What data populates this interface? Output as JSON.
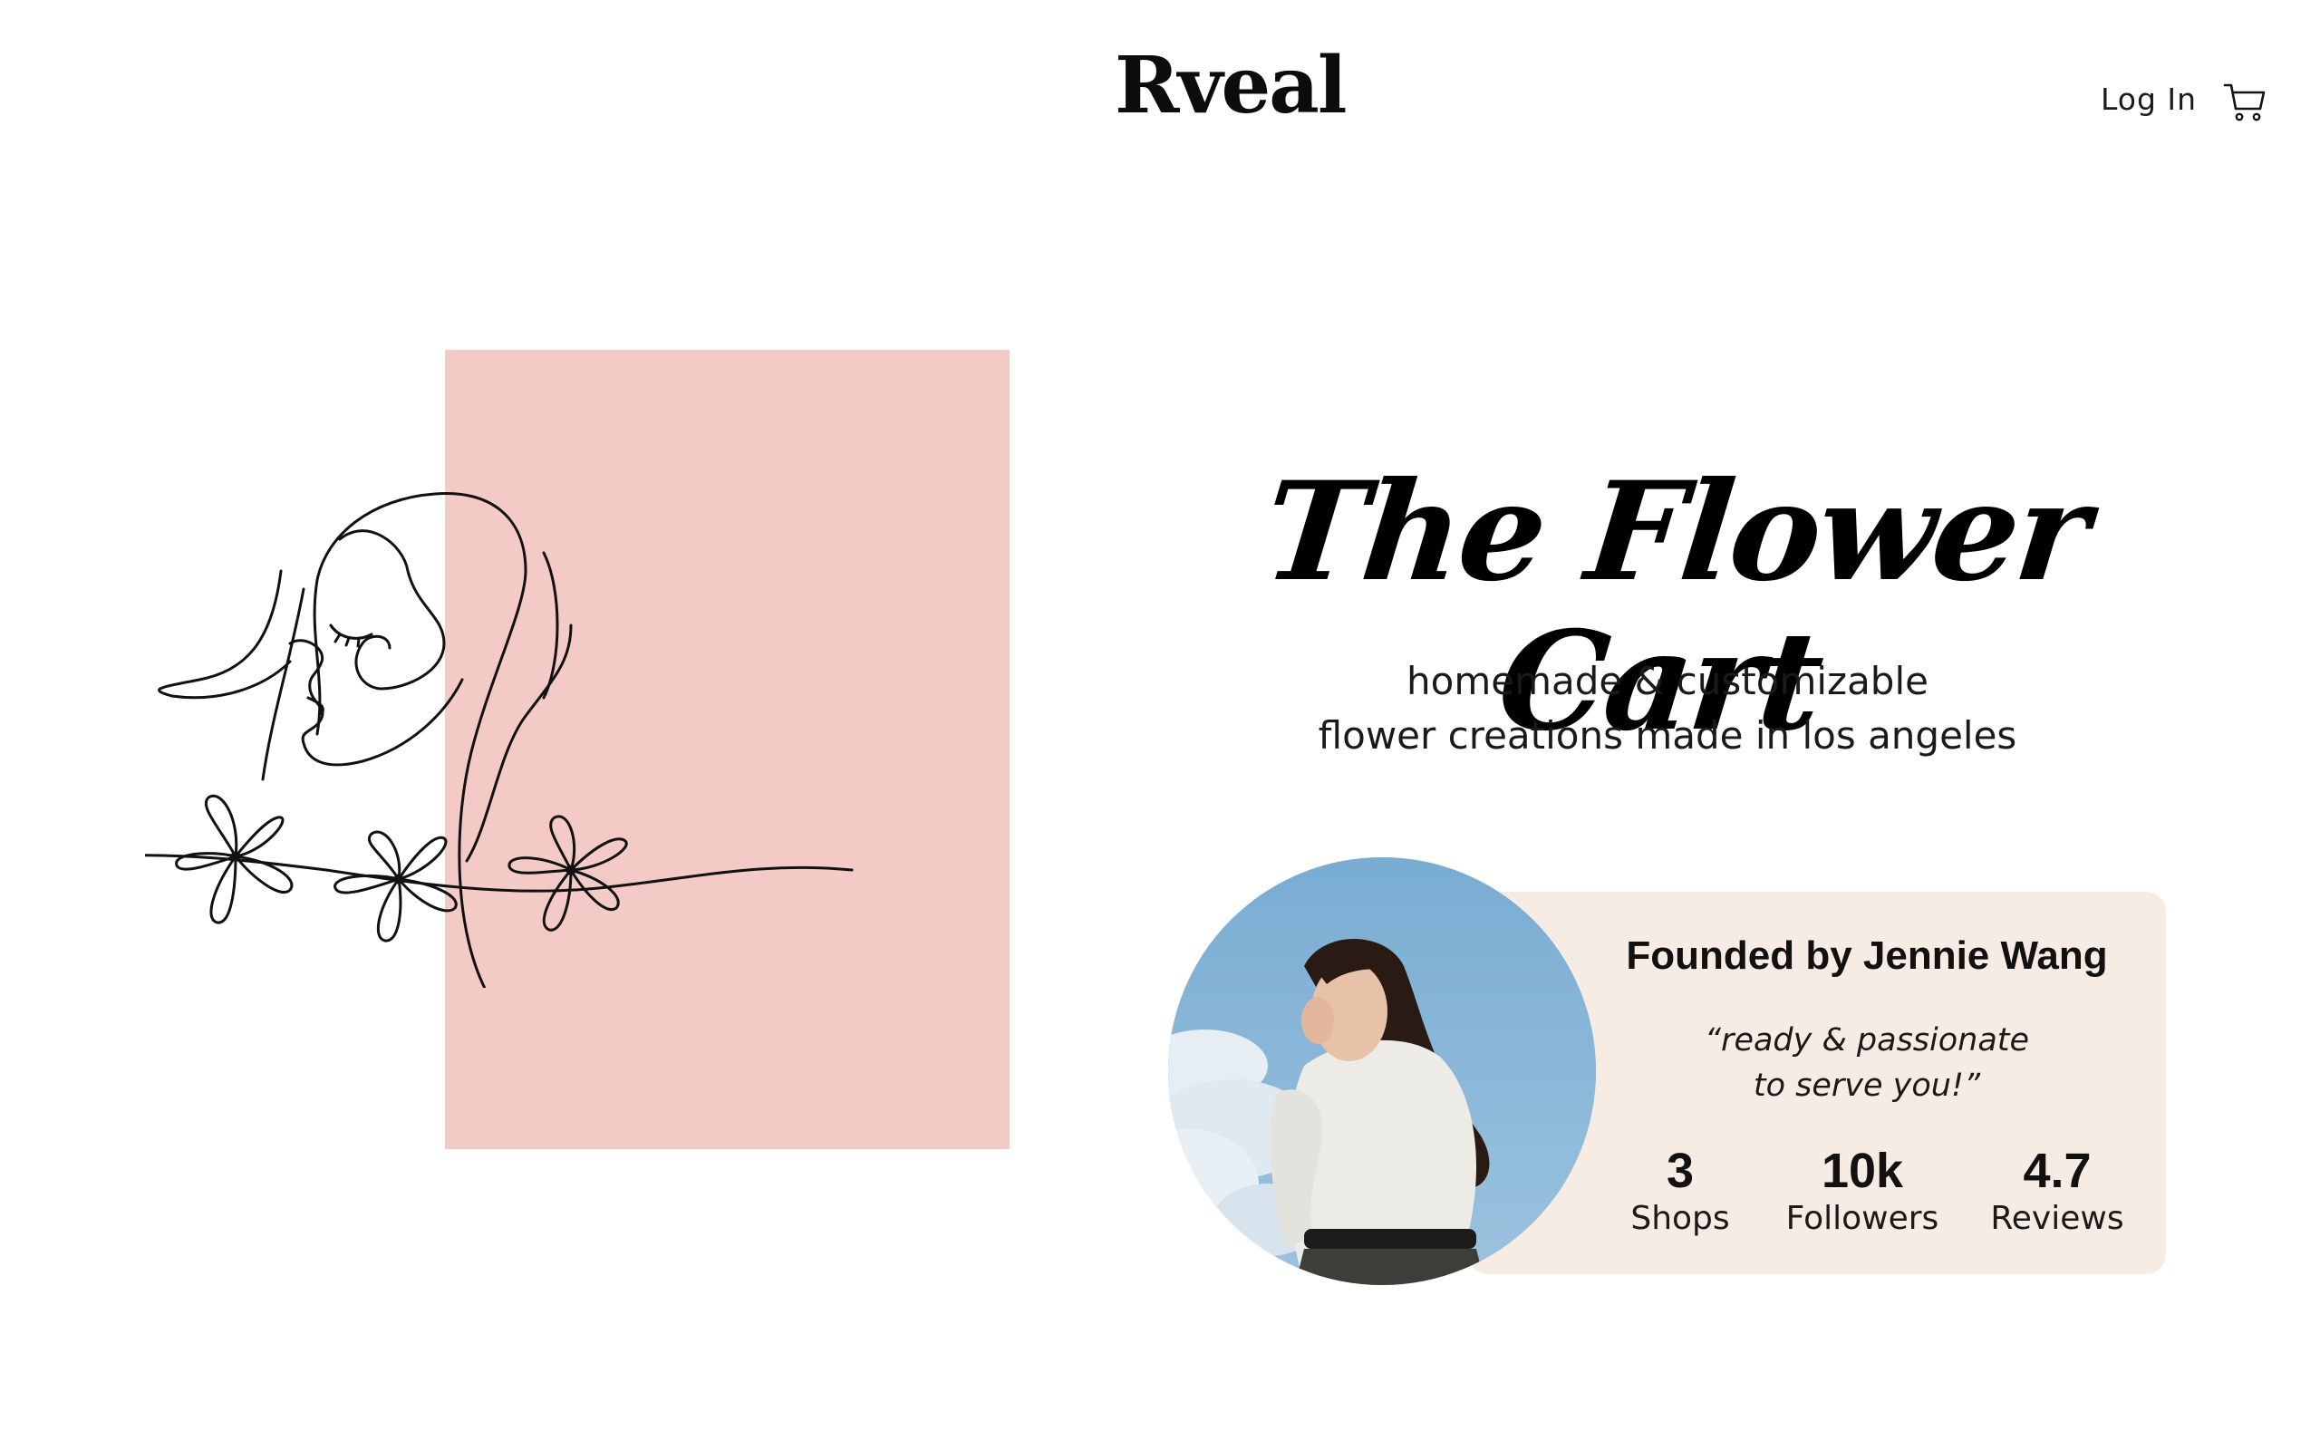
{
  "header": {
    "brand": "Rveal",
    "login_label": "Log In",
    "cart_icon": "shopping-cart-icon"
  },
  "hero": {
    "title": "The Flower Cart",
    "subtitle_lines": [
      "homemade & customizable",
      "flower creations made in los angeles"
    ],
    "panel_color": "#f3cac6",
    "illustration": "line-art-woman-with-flowers"
  },
  "founder": {
    "heading": "Founded by Jennie Wang",
    "quote_lines": [
      "“ready & passionate",
      "to serve you!”"
    ],
    "card_color": "#f6ece3",
    "photo": "founder-portrait",
    "stats": [
      {
        "value": "3",
        "label": "Shops"
      },
      {
        "value": "10k",
        "label": "Followers"
      },
      {
        "value": "4.7",
        "label": "Reviews"
      }
    ]
  }
}
